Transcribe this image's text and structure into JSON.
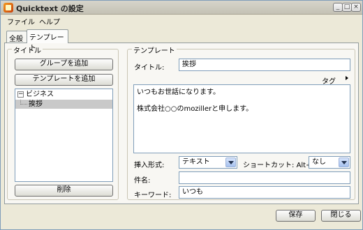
{
  "window": {
    "title": "Quicktext の設定"
  },
  "menubar": {
    "file": "ファイル",
    "help": "ヘルプ"
  },
  "tabs": {
    "all": "全般",
    "template": "テンプレート"
  },
  "left_panel": {
    "legend": "タイトル",
    "add_group_button": "グループを追加",
    "add_template_button": "テンプレートを追加",
    "delete_button": "削除",
    "tree": {
      "group_label": "ビジネス",
      "group_expander": "−",
      "selected_item": "挨拶"
    }
  },
  "right_panel": {
    "legend": "テンプレート",
    "title_label": "タイトル:",
    "title_value": "挨拶",
    "tag_label": "タグ",
    "body_lines": [
      "いつもお世話になります。",
      "株式会社○○のmozillerと申します。"
    ],
    "insert_label": "挿入形式:",
    "insert_value": "テキスト",
    "shortcut_label": "ショートカット:",
    "shortcut_modifier": "Alt+",
    "shortcut_value": "なし",
    "subject_label": "件名:",
    "subject_value": "",
    "keyword_label": "キーワード:",
    "keyword_value": "いつも"
  },
  "footer": {
    "save_button": "保存",
    "close_button": "閉じる"
  },
  "icons": {
    "app": "quicktext-app-icon",
    "min": "minimize-icon",
    "max": "maximize-icon",
    "close": "close-icon",
    "tag": "chevron-right-icon"
  }
}
